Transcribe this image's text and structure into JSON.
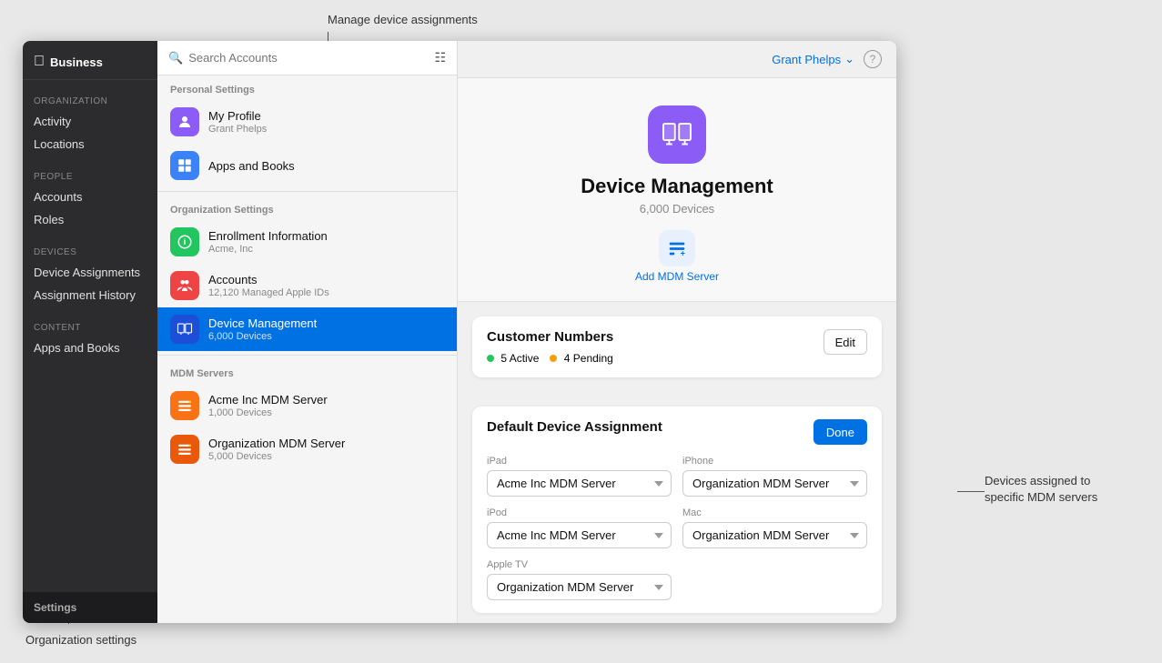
{
  "annotations": {
    "manage_device": "Manage device assignments",
    "org_settings": "Organization settings",
    "devices_assigned": "Devices assigned to\nspecific MDM servers"
  },
  "sidebar": {
    "logo_text": "Business",
    "sections": [
      {
        "label": "Organization",
        "items": [
          "Activity",
          "Locations"
        ]
      },
      {
        "label": "People",
        "items": [
          "Accounts",
          "Roles"
        ]
      },
      {
        "label": "Devices",
        "items": [
          "Device Assignments",
          "Assignment History"
        ]
      },
      {
        "label": "Content",
        "items": [
          "Apps and Books"
        ]
      }
    ],
    "footer": "Settings"
  },
  "middle_panel": {
    "search_placeholder": "Search Accounts",
    "personal_settings_label": "Personal Settings",
    "personal_items": [
      {
        "title": "My Profile",
        "sub": "Grant Phelps",
        "icon": "person"
      },
      {
        "title": "Apps and Books",
        "sub": "",
        "icon": "apps"
      }
    ],
    "org_settings_label": "Organization Settings",
    "org_items": [
      {
        "title": "Enrollment Information",
        "sub": "Acme, Inc",
        "icon": "info"
      },
      {
        "title": "Accounts",
        "sub": "12,120 Managed Apple IDs",
        "icon": "accounts"
      },
      {
        "title": "Device Management",
        "sub": "6,000 Devices",
        "icon": "devices",
        "active": true
      }
    ],
    "mdm_label": "MDM Servers",
    "mdm_items": [
      {
        "title": "Acme Inc MDM Server",
        "sub": "1,000 Devices",
        "icon": "server"
      },
      {
        "title": "Organization MDM Server",
        "sub": "5,000 Devices",
        "icon": "server2"
      }
    ]
  },
  "main": {
    "user_button": "Grant Phelps",
    "hero": {
      "title": "Device Management",
      "sub": "6,000 Devices",
      "add_mdm_label": "Add MDM\nServer"
    },
    "customer_numbers": {
      "title": "Customer Numbers",
      "active_count": "5",
      "active_label": "Active",
      "pending_count": "4",
      "pending_label": "Pending",
      "edit_label": "Edit"
    },
    "default_assignment": {
      "title": "Default Device Assignment",
      "done_label": "Done",
      "fields": [
        {
          "label": "iPad",
          "value": "Acme Inc MDM Server"
        },
        {
          "label": "iPhone",
          "value": "Organization MDM Server"
        },
        {
          "label": "iPod",
          "value": "Acme Inc MDM Server"
        },
        {
          "label": "Mac",
          "value": "Organization MDM Server"
        },
        {
          "label": "Apple TV",
          "value": "Organization MDM Server"
        }
      ]
    }
  }
}
